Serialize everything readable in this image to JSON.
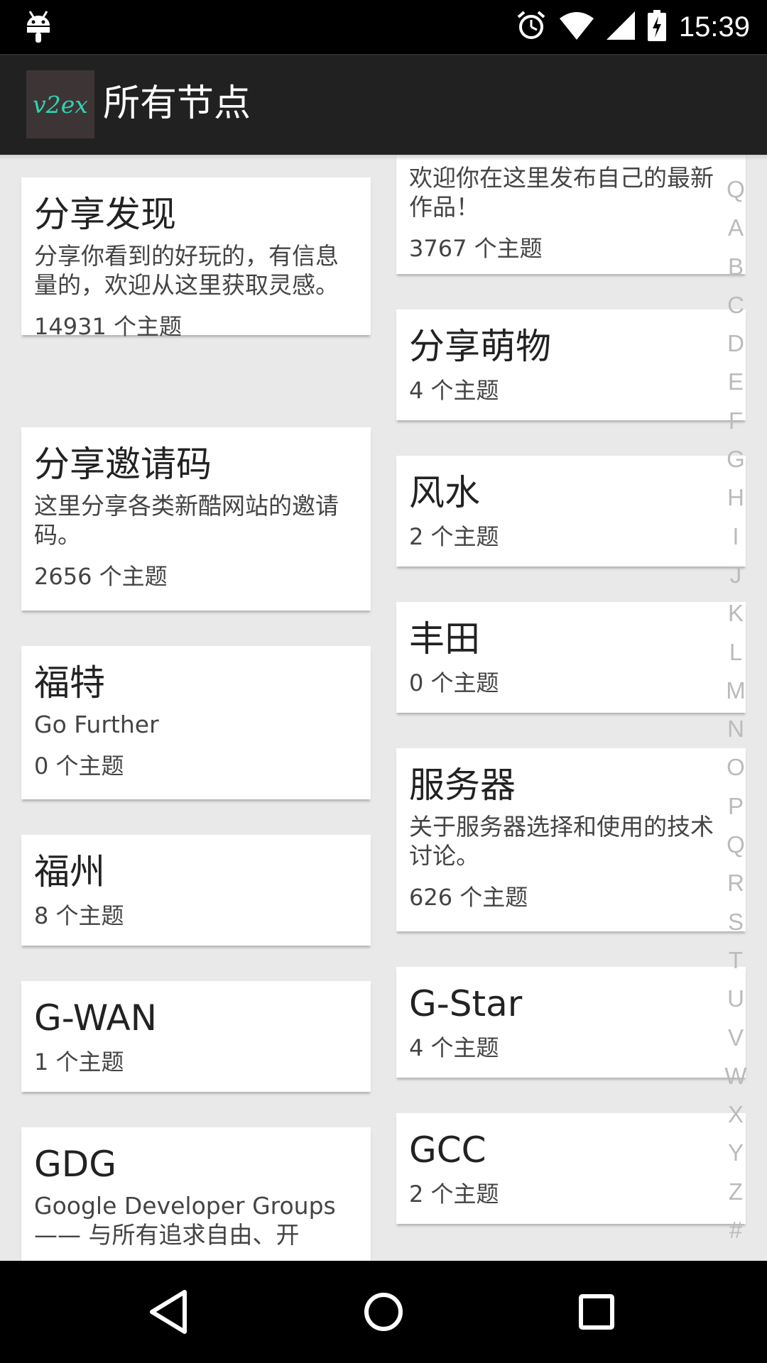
{
  "status_bar": {
    "time": "15:39",
    "icons": [
      "android-debug-icon",
      "alarm-icon",
      "wifi-icon",
      "signal-icon",
      "battery-charging-icon"
    ]
  },
  "app_bar": {
    "logo_text": "v2ex",
    "title": "所有节点"
  },
  "cards": [
    {
      "name": "分享发现",
      "description": "分享你看到的好玩的，有信息量的，欢迎从这里获取灵感。",
      "count": "14931 个主题"
    },
    {
      "name": "分享邀请码",
      "description": "这里分享各类新酷网站的邀请码。",
      "count": "2656 个主题"
    },
    {
      "name": "福特",
      "description": "Go Further",
      "count": "0 个主题"
    },
    {
      "name": "福州",
      "description": "",
      "count": "8 个主题"
    },
    {
      "name": "G-WAN",
      "description": "",
      "count": "1 个主题"
    },
    {
      "name": "GDG",
      "description": "Google Developer Groups —— 与所有追求自由、开",
      "count": ""
    },
    {
      "name": "",
      "description": "欢迎你在这里发布自己的最新作品！",
      "count": "3767 个主题"
    },
    {
      "name": "分享萌物",
      "description": "",
      "count": "4 个主题"
    },
    {
      "name": "风水",
      "description": "",
      "count": "2 个主题"
    },
    {
      "name": "丰田",
      "description": "",
      "count": "0 个主题"
    },
    {
      "name": "服务器",
      "description": "关于服务器选择和使用的技术讨论。",
      "count": "626 个主题"
    },
    {
      "name": "G-Star",
      "description": "",
      "count": "4 个主题"
    },
    {
      "name": "GCC",
      "description": "",
      "count": "2 个主题"
    }
  ],
  "index_letters": [
    "Q",
    "A",
    "B",
    "C",
    "D",
    "E",
    "F",
    "G",
    "H",
    "I",
    "J",
    "K",
    "L",
    "M",
    "N",
    "O",
    "P",
    "Q",
    "R",
    "S",
    "T",
    "U",
    "V",
    "W",
    "X",
    "Y",
    "Z",
    "#"
  ],
  "nav_bar": {
    "icons": [
      "back-icon",
      "home-icon",
      "recents-icon"
    ]
  },
  "colors": {
    "status_bar": "#000000",
    "app_bar": "#212121",
    "background": "#e9e9e9",
    "card": "#ffffff",
    "logo_bg": "#3d3535",
    "logo_text": "#30d2b4"
  }
}
